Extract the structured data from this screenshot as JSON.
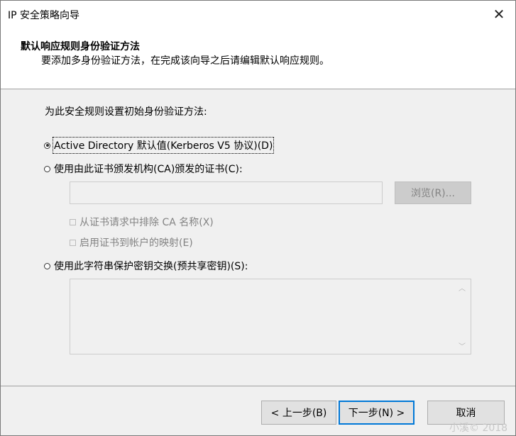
{
  "window": {
    "title": "IP 安全策略向导",
    "close_glyph": "✕"
  },
  "header": {
    "title": "默认响应规则身份验证方法",
    "subtitle": "要添加多身份验证方法，在完成该向导之后请编辑默认响应规则。"
  },
  "content": {
    "intro": "为此安全规则设置初始身份验证方法:",
    "option_ad": {
      "label": "Active Directory 默认值(Kerberos V5 协议)(D)",
      "selected": true
    },
    "option_cert": {
      "label": "使用由此证书颁发机构(CA)颁发的证书(C):",
      "selected": false
    },
    "cert_value": "",
    "browse_label": "浏览(R)...",
    "check_exclude": {
      "label": "从证书请求中排除 CA 名称(X)",
      "checked": false
    },
    "check_mapping": {
      "label": "启用证书到帐户的映射(E)",
      "checked": false
    },
    "option_psk": {
      "label": "使用此字符串保护密钥交换(预共享密钥)(S):",
      "selected": false
    },
    "psk_value": ""
  },
  "footer": {
    "back_label": "< 上一步(B)",
    "next_label": "下一步(N) >",
    "cancel_label": "取消"
  },
  "watermark": "小溪© 2018"
}
